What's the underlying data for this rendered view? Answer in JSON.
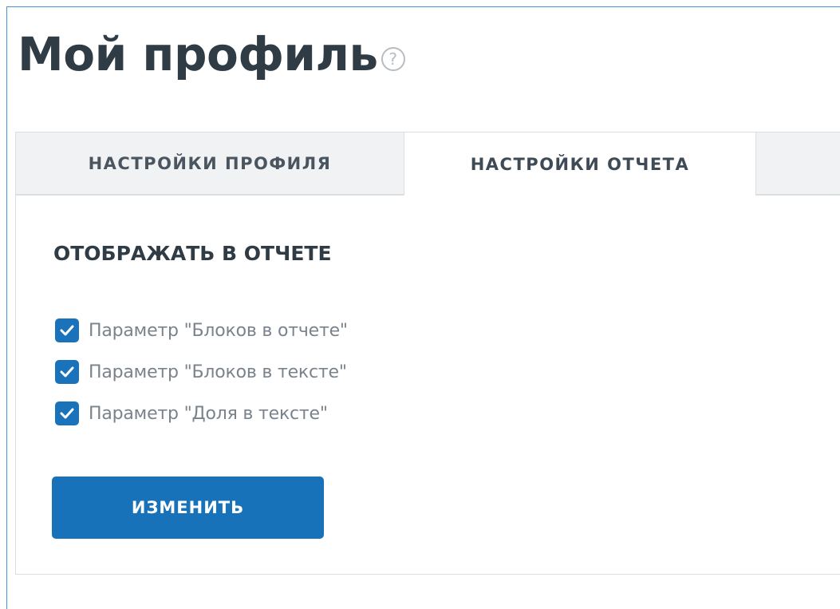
{
  "header": {
    "title": "Мой профиль",
    "help_icon": "question-circle-icon",
    "help_glyph": "?"
  },
  "tabs": [
    {
      "label": "НАСТРОЙКИ ПРОФИЛЯ",
      "active": false
    },
    {
      "label": "НАСТРОЙКИ ОТЧЕТА",
      "active": true
    }
  ],
  "report_settings": {
    "section_title": "ОТОБРАЖАТЬ В ОТЧЕТЕ",
    "options": [
      {
        "label": "Параметр \"Блоков в отчете\"",
        "checked": true
      },
      {
        "label": "Параметр \"Блоков в тексте\"",
        "checked": true
      },
      {
        "label": "Параметр \"Доля в тексте\"",
        "checked": true
      }
    ],
    "submit_label": "ИЗМЕНИТЬ"
  },
  "colors": {
    "accent": "#1872ba",
    "title": "#2f3b45",
    "frame_border": "#4a90d9"
  }
}
